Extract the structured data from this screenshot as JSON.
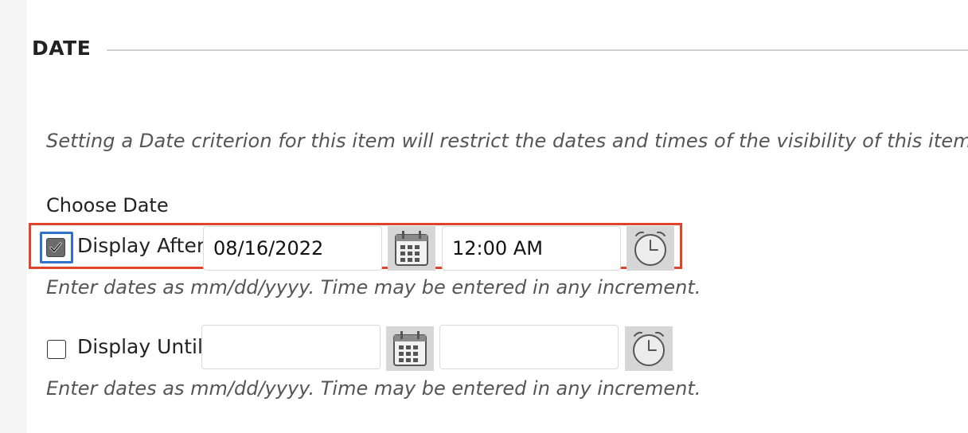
{
  "section": {
    "title": "DATE"
  },
  "instruction": "Setting a Date criterion for this item will restrict the dates and times of the visibility of this item.",
  "choose_label": "Choose Date",
  "display_after": {
    "label": "Display After",
    "checked": true,
    "date_value": "08/16/2022",
    "time_value": "12:00 AM",
    "hint": "Enter dates as mm/dd/yyyy. Time may be entered in any increment."
  },
  "display_until": {
    "label": "Display Until",
    "checked": false,
    "date_value": "",
    "time_value": "",
    "hint": "Enter dates as mm/dd/yyyy. Time may be entered in any increment."
  },
  "icons": {
    "calendar": "calendar-icon",
    "clock": "clock-icon",
    "checkmark": "checkmark-icon"
  },
  "colors": {
    "highlight": "#e0452b",
    "focus_ring": "#2f73c8",
    "icon_button_bg": "#d6d6d6"
  }
}
